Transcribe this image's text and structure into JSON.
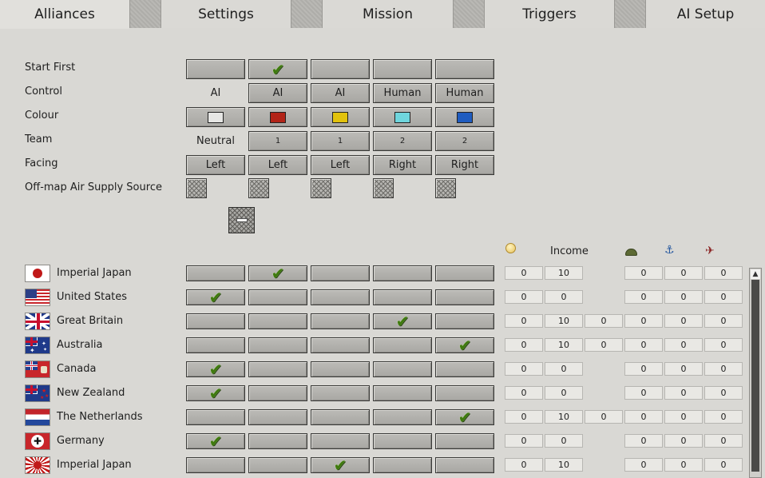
{
  "tabs": [
    {
      "label": "Alliances",
      "active": true
    },
    {
      "label": "Settings"
    },
    {
      "label": "Mission"
    },
    {
      "label": "Triggers"
    },
    {
      "label": "AI Setup"
    }
  ],
  "settings": {
    "start_first_label": "Start First",
    "control_label": "Control",
    "colour_label": "Colour",
    "team_label": "Team",
    "facing_label": "Facing",
    "air_supply_label": "Off-map Air Supply Source",
    "start_first_checked": [
      false,
      true,
      false,
      false,
      false
    ],
    "control": [
      "AI",
      "AI",
      "AI",
      "Human",
      "Human"
    ],
    "colours": [
      "#e6e6e4",
      "#b22418",
      "#e2c20c",
      "#6fd6dd",
      "#1f5cc0"
    ],
    "team": [
      "Neutral",
      "1",
      "1",
      "2",
      "2"
    ],
    "facing": [
      "Left",
      "Left",
      "Left",
      "Right",
      "Right"
    ]
  },
  "resources_header": {
    "income_label": "Income",
    "icons": [
      "gold-coin-icon",
      "helmet-icon",
      "anchor-icon",
      "plane-icon"
    ]
  },
  "nations": [
    {
      "name": "Imperial Japan",
      "flag": "japan",
      "checked": 1,
      "values": [
        "0",
        "10",
        "",
        "0",
        "0",
        "0"
      ]
    },
    {
      "name": "United States",
      "flag": "usa",
      "checked": 0,
      "values": [
        "0",
        "0",
        "",
        "0",
        "0",
        "0"
      ]
    },
    {
      "name": "Great Britain",
      "flag": "uk",
      "checked": 3,
      "values": [
        "0",
        "10",
        "0",
        "0",
        "0",
        "0"
      ]
    },
    {
      "name": "Australia",
      "flag": "australia",
      "checked": 4,
      "values": [
        "0",
        "10",
        "0",
        "0",
        "0",
        "0"
      ]
    },
    {
      "name": "Canada",
      "flag": "canada",
      "checked": 0,
      "values": [
        "0",
        "0",
        "",
        "0",
        "0",
        "0"
      ]
    },
    {
      "name": "New Zealand",
      "flag": "newzealand",
      "checked": 0,
      "values": [
        "0",
        "0",
        "",
        "0",
        "0",
        "0"
      ]
    },
    {
      "name": "The Netherlands",
      "flag": "netherlands",
      "checked": 4,
      "values": [
        "0",
        "10",
        "0",
        "0",
        "0",
        "0"
      ]
    },
    {
      "name": "Germany",
      "flag": "germany",
      "checked": 0,
      "values": [
        "0",
        "0",
        "",
        "0",
        "0",
        "0"
      ]
    },
    {
      "name": "Imperial Japan",
      "flag": "japan-rising",
      "checked": 2,
      "values": [
        "0",
        "10",
        "",
        "0",
        "0",
        "0"
      ]
    }
  ],
  "theme": {
    "check_color": "#3f7a0e",
    "panel_bg": "#d9d8d4"
  }
}
